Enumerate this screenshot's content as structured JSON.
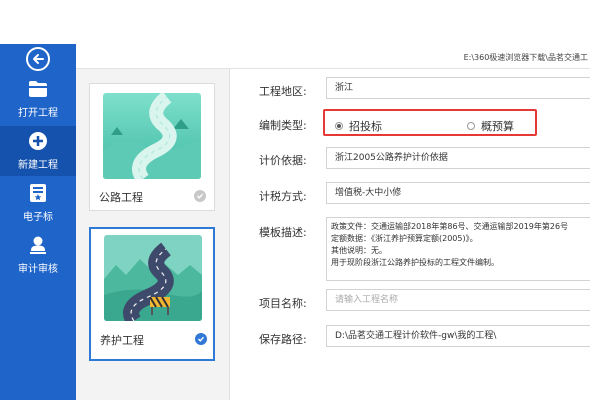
{
  "header": {
    "path": "E:\\360极速浏览器下载\\品茗交通工"
  },
  "sidebar": {
    "back": "back",
    "items": [
      {
        "label": "打开工程",
        "icon": "folder-icon"
      },
      {
        "label": "新建工程",
        "icon": "plus-circle-icon",
        "active": true
      },
      {
        "label": "电子标",
        "icon": "bid-document-icon"
      },
      {
        "label": "审计审核",
        "icon": "audit-user-icon"
      }
    ]
  },
  "templates": [
    {
      "name": "公路工程",
      "selected": false
    },
    {
      "name": "养护工程",
      "selected": true
    }
  ],
  "form": {
    "region": {
      "label": "工程地区:",
      "value": "浙江"
    },
    "type": {
      "label": "编制类型:",
      "options": [
        "招投标",
        "概预算"
      ],
      "selected": "招投标"
    },
    "basis": {
      "label": "计价依据:",
      "value": "浙江2005公路养护计价依据"
    },
    "tax": {
      "label": "计税方式:",
      "value": "增值税-大中小修"
    },
    "desc": {
      "label": "模板描述:",
      "lines": [
        "政策文件：交通运输部2018年第86号、交通运输部2019年第26号",
        "定额数据：《浙江养护预算定额(2005)》。",
        "其他说明：无。",
        "用于现阶段浙江公路养护投标的工程文件编制。"
      ]
    },
    "name": {
      "label": "项目名称:",
      "placeholder": "请输入工程名称",
      "value": ""
    },
    "path": {
      "label": "保存路径:",
      "value": "D:\\品茗交通工程计价软件-gw\\我的工程\\"
    }
  },
  "colors": {
    "sidebar": "#1f64c8",
    "sidebar_active": "#1552ad",
    "highlight": "#e53935",
    "accent": "#2f78d6"
  }
}
